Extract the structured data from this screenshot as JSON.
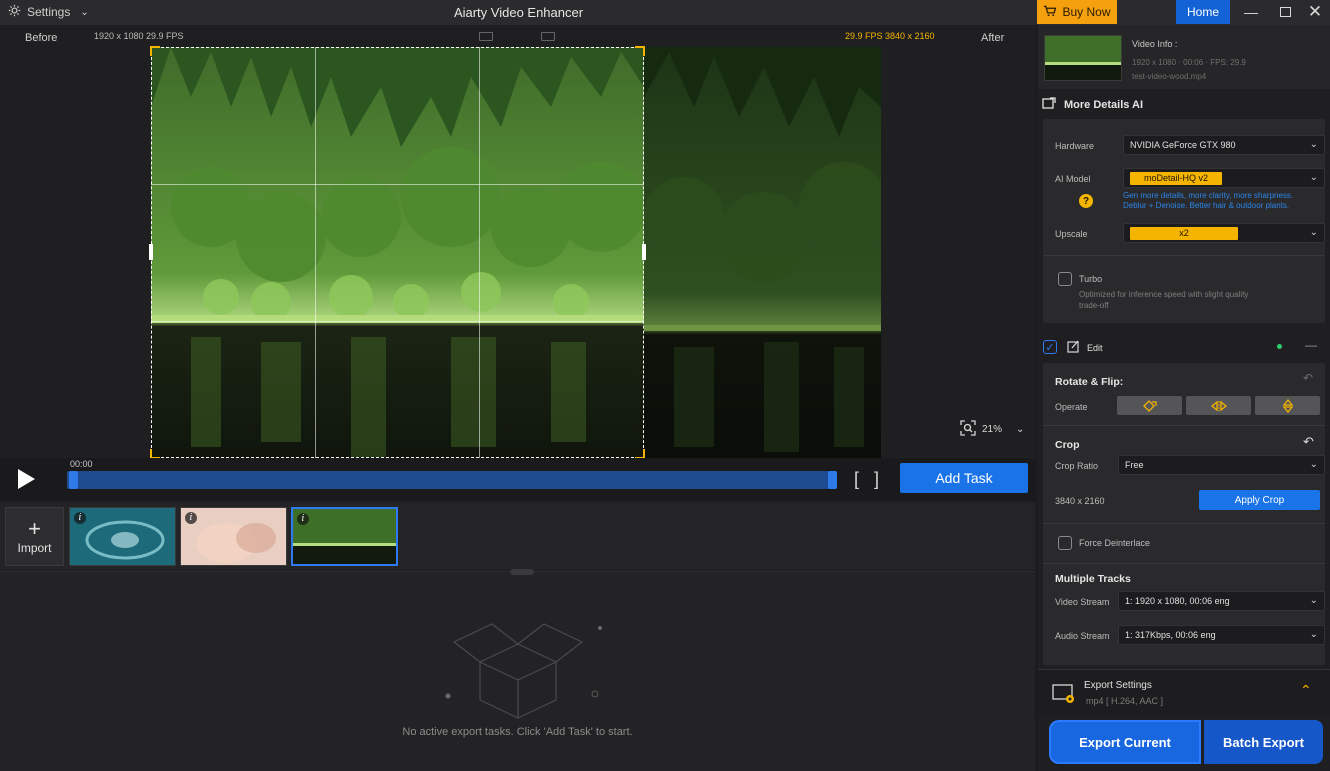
{
  "titlebar": {
    "settings_label": "Settings",
    "app_title": "Aiarty Video Enhancer",
    "buy_now_label": "Buy Now",
    "home_label": "Home"
  },
  "preview": {
    "before_label": "Before",
    "after_label": "After",
    "before_info": "1920 x 1080  29.9 FPS",
    "after_info": "29.9 FPS  3840 x 2160",
    "zoom_level": "21%"
  },
  "timeline": {
    "current_time": "00:00",
    "add_task_label": "Add Task"
  },
  "thumbnails": {
    "import_label": "Import"
  },
  "task_area": {
    "empty_message": "No active export tasks. Click 'Add Task' to start."
  },
  "video_info": {
    "title": "Video Info :",
    "details": "1920 x 1080 · 00:06 · FPS: 29.9",
    "filename": "test-video-wood.mp4"
  },
  "ai_section": {
    "title": "More Details AI",
    "hardware_label": "Hardware",
    "hardware_value": "NVIDIA GeForce GTX 980",
    "model_label": "AI Model",
    "model_value": "moDetail-HQ  v2",
    "model_desc_1": "Gen more details, more clarity, more sharpness.",
    "model_desc_2": "Deblur + Denoise. Better hair & outdoor plants.",
    "upscale_label": "Upscale",
    "upscale_value": "x2",
    "turbo_label": "Turbo",
    "turbo_desc_1": "Optimized for inference speed with slight quality",
    "turbo_desc_2": "trade-off"
  },
  "edit_section": {
    "title": "Edit",
    "rotate_title": "Rotate & Flip:",
    "operate_label": "Operate",
    "crop_title": "Crop",
    "crop_ratio_label": "Crop Ratio",
    "crop_ratio_value": "Free",
    "crop_size": "3840 x 2160",
    "apply_crop_label": "Apply Crop",
    "deinterlace_label": "Force Deinterlace",
    "tracks_title": "Multiple Tracks",
    "video_stream_label": "Video Stream",
    "video_stream_value": "1: 1920 x 1080,  00:06   eng",
    "audio_stream_label": "Audio Stream",
    "audio_stream_value": "1: 317Kbps,  00:06   eng"
  },
  "export": {
    "settings_title": "Export Settings",
    "settings_format": "mp4 [ H.264, AAC ]",
    "export_current_label": "Export Current",
    "batch_export_label": "Batch Export"
  },
  "colors": {
    "accent_blue": "#1a74e8",
    "accent_yellow": "#f4b400",
    "buy_orange": "#f5a00f"
  }
}
